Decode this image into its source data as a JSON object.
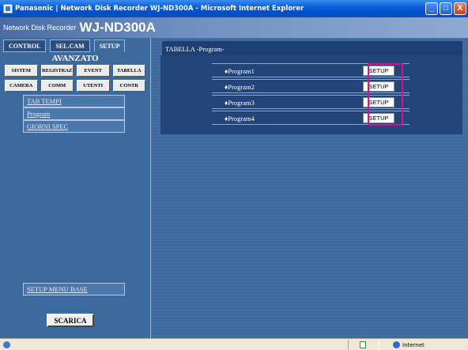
{
  "window": {
    "title": "Panasonic | Network Disk Recorder WJ-ND300A - Microsoft Internet Explorer",
    "buttons": [
      "_",
      "□",
      "X"
    ]
  },
  "header": {
    "small": "Network Disk Recorder",
    "model": "WJ-ND300A"
  },
  "tabs": [
    {
      "label": "CONTROL"
    },
    {
      "label": "SEL.CAM"
    },
    {
      "label": "SETUP"
    }
  ],
  "section_title": "AVANZATO",
  "menu_buttons": [
    "SISTEM",
    "REGISTRAZ",
    "EVENT",
    "TABELLA",
    "CAMERA",
    "COMM",
    "UTENTI",
    "CONTR"
  ],
  "sub_items": [
    "TAB TEMPI",
    "Program",
    "GIORNI SPEC"
  ],
  "setup_base": "SETUP MENU BASE",
  "download_button": "SCARICA",
  "panel_title": "TABELLA -Program-",
  "programs": [
    {
      "label": "♦Program1",
      "button": "SETUP"
    },
    {
      "label": "♦Program2",
      "button": "SETUP"
    },
    {
      "label": "♦Program3",
      "button": "SETUP"
    },
    {
      "label": "♦Program4",
      "button": "SETUP"
    }
  ],
  "status": {
    "zone": "Internet"
  },
  "colors": {
    "highlight": "#d4148a",
    "panel_dark": "#24457a",
    "panel_bg": "#3e6aa0"
  }
}
